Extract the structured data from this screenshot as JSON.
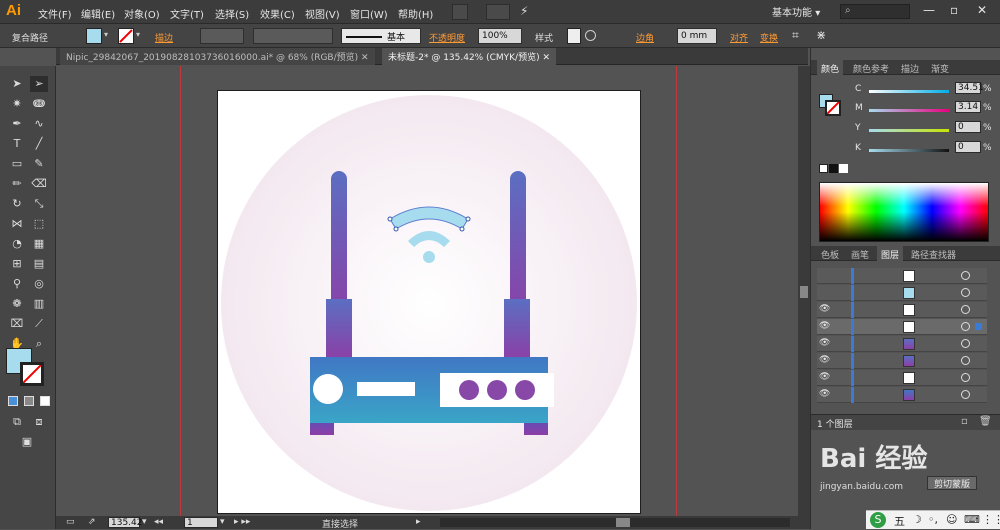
{
  "app": {
    "logo": "Ai"
  },
  "menu": [
    "文件(F)",
    "编辑(E)",
    "对象(O)",
    "文字(T)",
    "选择(S)",
    "效果(C)",
    "视图(V)",
    "窗口(W)",
    "帮助(H)"
  ],
  "workspace": {
    "label": "基本功能",
    "arrow": "▾"
  },
  "control": {
    "selection_type": "复合路径",
    "stroke_label": "描边",
    "brush_label": "基本",
    "opacity_label": "不透明度",
    "opacity_value": "100%",
    "style_label": "样式",
    "corner_label": "边角",
    "corner_value": "0 mm",
    "align_label": "对齐",
    "transform_label": "变换"
  },
  "tabs": [
    {
      "label": "Nipic_29842067_20190828103736016000.ai* @ 68% (RGB/预览)",
      "active": false
    },
    {
      "label": "未标题-2* @ 135.42% (CMYK/预览)",
      "active": true
    }
  ],
  "status": {
    "zoom": "135.42",
    "page": "1",
    "tool": "直接选择"
  },
  "color_panel": {
    "tabs": [
      "颜色",
      "颜色参考",
      "描边",
      "渐变"
    ],
    "sliders": [
      {
        "label": "C",
        "value": "34.51",
        "color": "#00aee8"
      },
      {
        "label": "M",
        "value": "3.14",
        "color": "#e8007e"
      },
      {
        "label": "Y",
        "value": "0",
        "color": "#f2e400"
      },
      {
        "label": "K",
        "value": "0",
        "color": "#222222"
      }
    ],
    "pct": "%"
  },
  "layers_panel": {
    "tabs": [
      "色板",
      "画笔",
      "图层",
      "路径查找器"
    ],
    "count": "1 个图层"
  },
  "watermark": {
    "text": "Bai 经验",
    "sub": "jingyan.baidu.com"
  },
  "right_buttons": [
    "剪切",
    "蒙版"
  ],
  "colors": {
    "fill": "#a7dbee",
    "accent_orange": "#ff9a00",
    "router_top": "#4077c4",
    "router_bottom": "#3aa5c7",
    "antenna_top": "#5b6fc2",
    "antenna_bottom": "#8c3fa6",
    "button_purple": "#8848a8",
    "wifi": "#a7dbee"
  }
}
